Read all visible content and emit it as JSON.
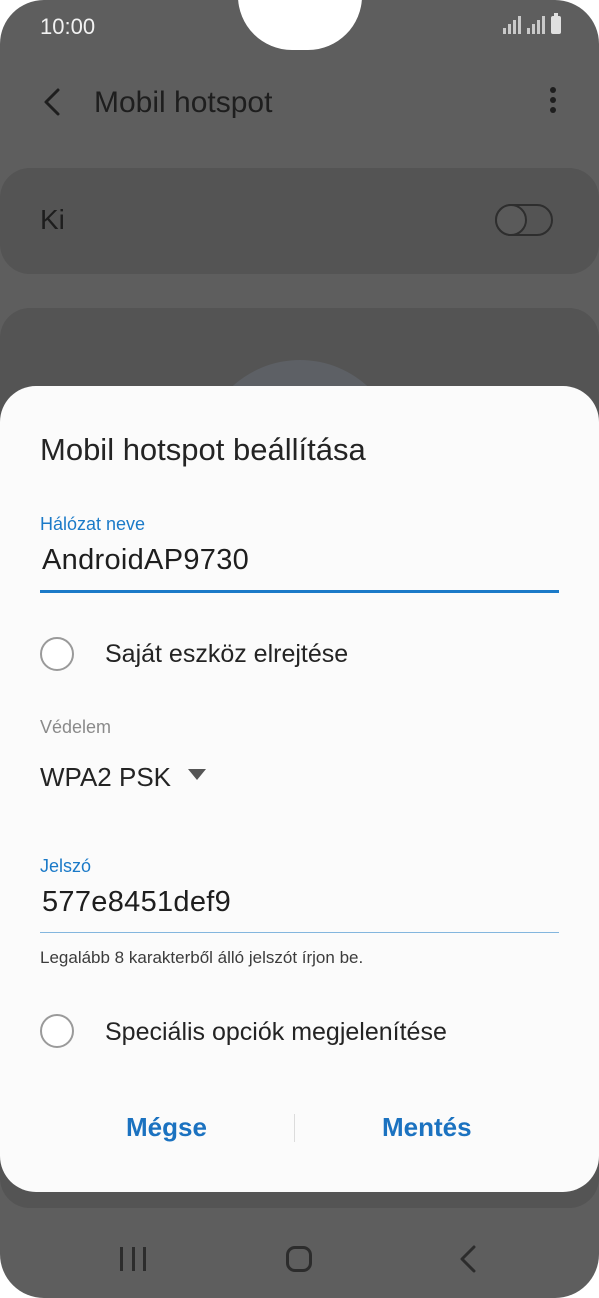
{
  "status_bar": {
    "time": "10:00",
    "icons": [
      "signal-icon",
      "signal-icon",
      "battery-icon"
    ]
  },
  "app_bar": {
    "title": "Mobil hotspot",
    "back_icon": "back-arrow-icon",
    "more_icon": "more-vert-icon"
  },
  "hotspot_switch": {
    "label": "Ki",
    "state": "off"
  },
  "dialog": {
    "title": "Mobil hotspot beállítása",
    "network_name": {
      "label": "Hálózat neve",
      "value": "AndroidAP9730"
    },
    "hide_device": {
      "label": "Saját eszköz elrejtése",
      "checked": false
    },
    "security": {
      "label": "Védelem",
      "value": "WPA2 PSK"
    },
    "password": {
      "label": "Jelszó",
      "value": "577e8451def9",
      "hint": "Legalább 8 karakterből álló jelszót írjon be."
    },
    "advanced": {
      "label": "Speciális opciók megjelenítése",
      "checked": false
    },
    "buttons": {
      "cancel": "Mégse",
      "save": "Mentés"
    }
  },
  "nav_bar": {
    "icons": [
      "recents-icon",
      "home-icon",
      "back-icon"
    ]
  },
  "colors": {
    "accent": "#1b7ac8",
    "scrim": "#5e5e5e",
    "dialog_bg": "#fbfbfb"
  }
}
